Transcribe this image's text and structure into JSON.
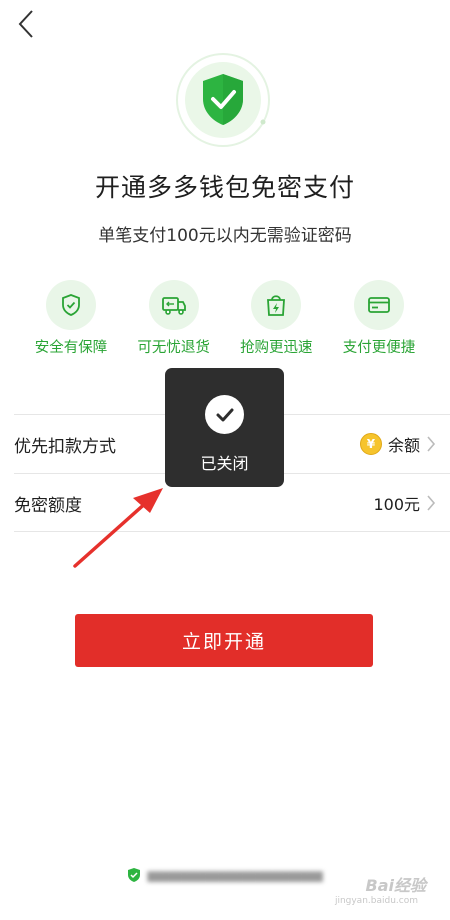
{
  "header": {
    "back_icon": "chevron-left-icon"
  },
  "hero": {
    "icon": "shield-check-icon",
    "accent": "#2db441"
  },
  "title": "开通多多钱包免密支付",
  "subtitle": "单笔支付100元以内无需验证密码",
  "features": [
    {
      "icon": "shield-icon",
      "label": "安全有保障"
    },
    {
      "icon": "truck-refund-icon",
      "label": "可无忧退货"
    },
    {
      "icon": "flash-bag-icon",
      "label": "抢购更迅速"
    },
    {
      "icon": "card-icon",
      "label": "支付更便捷"
    }
  ],
  "settings": {
    "payment_method": {
      "label": "优先扣款方式",
      "value": "余额",
      "icon": "coin-icon",
      "coin_symbol": "¥"
    },
    "limit": {
      "label": "免密额度",
      "value": "100元"
    }
  },
  "primary_button": {
    "label": "立即开通",
    "color": "#e22e29"
  },
  "toast": {
    "text": "已关闭",
    "icon": "check-circle-icon"
  },
  "annotation": {
    "icon": "red-arrow",
    "color": "#e6312c"
  },
  "watermark": {
    "text": "Bai经验",
    "sub": "jingyan.baidu.com"
  }
}
